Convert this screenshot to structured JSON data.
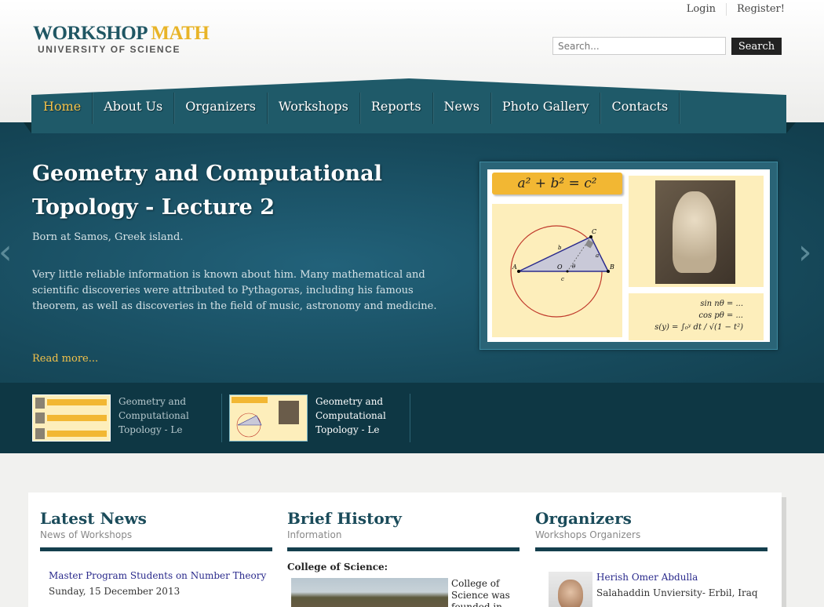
{
  "header": {
    "logo_word1": "WORKSHOP",
    "logo_word2": "MATH",
    "logo_subtitle": "UNIVERSITY OF SCIENCE",
    "login": "Login",
    "register": "Register!",
    "search_placeholder": "Search...",
    "search_button": "Search"
  },
  "nav": {
    "items": [
      "Home",
      "About Us",
      "Organizers",
      "Workshops",
      "Reports",
      "News",
      "Photo Gallery",
      "Contacts"
    ],
    "active": "Home"
  },
  "slider": {
    "title": "Geometry and Computational Topology - Lecture 2",
    "subtitle": "Born at Samos, Greek island.",
    "description": "Very little reliable information is known about him. Many mathematical and scientific discoveries were attributed to Pythagoras, including his famous theorem, as well as discoveries in the field of music, astronomy and medicine.",
    "read_more": "Read more...",
    "prev_arrow": "‹",
    "next_arrow": "›",
    "image": {
      "formula": "a² + b² = c²",
      "eq1": "sin nθ = ...",
      "eq2": "cos pθ = ...",
      "eq3": "s(y) = ∫₀ʸ dt / √(1 − t²)",
      "labels": {
        "A": "A",
        "B": "B",
        "C": "C",
        "O": "O",
        "a": "a",
        "b": "b",
        "c": "c",
        "theta": "θ"
      }
    },
    "thumbnails": [
      {
        "title": "Geometry and Computational Topology - Le"
      },
      {
        "title": "Geometry and Computational Topology - Le"
      }
    ]
  },
  "sections": {
    "news": {
      "title": "Latest News",
      "subtitle": "News of Workshops",
      "item_title": "Master Program Students on Number Theory",
      "item_date": "Sunday, 15 December 2013"
    },
    "history": {
      "title": "Brief History",
      "subtitle": "Information",
      "heading": "College of Science:",
      "text": "College of Science was founded in"
    },
    "organizers": {
      "title": "Organizers",
      "subtitle": "Workshops Organizers",
      "name": "Herish Omer Abdulla",
      "affiliation": "Salahaddin Unviersity- Erbil, Iraq"
    }
  },
  "colors": {
    "brand_teal": "#1f5663",
    "brand_gold": "#e8b428",
    "nav_teal": "#1f5a69",
    "slider_teal": "#174a5c",
    "active_gold": "#f3c24a"
  }
}
